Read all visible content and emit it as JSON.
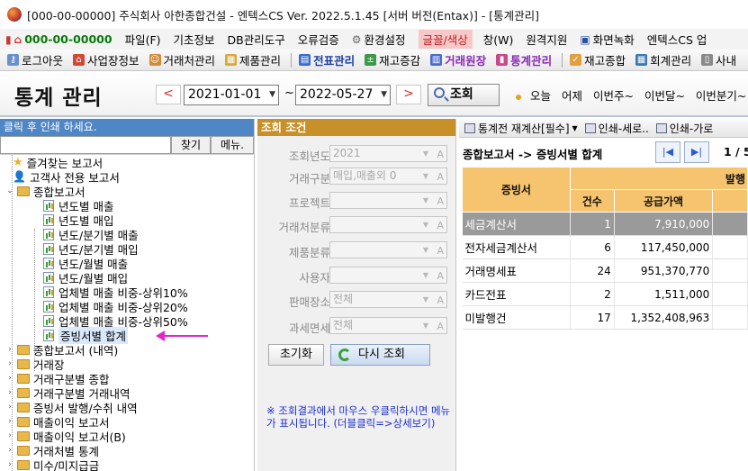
{
  "window": {
    "title": "[000-00-00000] 주식회사 아한종합건설 - 엔텍스CS Ver. 2022.5.1.45 [서버 버전(Entax)] - [통계관리]"
  },
  "menubar": {
    "code": "000-00-00000",
    "items": [
      "파일(F)",
      "기초정보",
      "DB관리도구",
      "오류검증",
      "환경설정",
      "글꼴/색상",
      "창(W)",
      "원격지원",
      "화면녹화",
      "엔텍스CS 업"
    ]
  },
  "toolbar": {
    "items": [
      "로그아웃",
      "사업장정보",
      "거래처관리",
      "제품관리",
      "전표관리",
      "재고증감",
      "거래원장",
      "통계관리",
      "재고종합",
      "회계관리",
      "사내"
    ]
  },
  "header": {
    "title": "통계 관리",
    "prev_label": "<",
    "next_label": ">",
    "date_from": "2021-01-01",
    "date_to": "2022-05-27",
    "tilde": "~",
    "search_label": "조회",
    "quick_ranges": [
      "오늘",
      "어제",
      "이번주~",
      "이번달~",
      "이번분기~"
    ]
  },
  "left": {
    "hint": "클릭 후 인쇄 하세요.",
    "find_label": "찾기",
    "menu_label": "메뉴.",
    "tree": [
      {
        "label": "즐겨찾는 보고서"
      },
      {
        "label": "고객사 전용 보고서"
      },
      {
        "label": "종합보고서"
      },
      {
        "label": "년도별 매출"
      },
      {
        "label": "년도별 매입"
      },
      {
        "label": "년도/분기별 매출"
      },
      {
        "label": "년도/분기별 매입"
      },
      {
        "label": "년도/월별 매출"
      },
      {
        "label": "년도/월별 매입"
      },
      {
        "label": "업체별 매출 비중-상위10%"
      },
      {
        "label": "업체별 매출 비중-상위20%"
      },
      {
        "label": "업체별 매출 비중-상위50%"
      },
      {
        "label": "증빙서별 합계"
      },
      {
        "label": "종합보고서 (내역)"
      },
      {
        "label": "거래장"
      },
      {
        "label": "거래구분별 종합"
      },
      {
        "label": "거래구분별 거래내역"
      },
      {
        "label": "증빙서 발행/수취 내역"
      },
      {
        "label": "매출이익 보고서"
      },
      {
        "label": "매출이익 보고서(B)"
      },
      {
        "label": "거래처별 통계"
      },
      {
        "label": "미수/미지급금"
      }
    ]
  },
  "conditions": {
    "header": "조회 조건",
    "fields": [
      {
        "label": "조회년도",
        "value": "2021"
      },
      {
        "label": "거래구분",
        "value": "매입,매출외 0"
      },
      {
        "label": "프로젝트",
        "value": ""
      },
      {
        "label": "거래처분류",
        "value": ""
      },
      {
        "label": "제품분류",
        "value": ""
      },
      {
        "label": "사용자",
        "value": ""
      },
      {
        "label": "판매장소",
        "value": "전체"
      },
      {
        "label": "과세면세",
        "value": "전체"
      }
    ],
    "abtn": "A",
    "reset_label": "초기화",
    "requery_label": "다시 조회",
    "note": "※ 조회결과에서 마우스 우클릭하시면 메뉴가 표시됩니다. (더블클릭=>상세보기)"
  },
  "results": {
    "toolbar": [
      "통계전 재계산[필수]",
      "인쇄-세로..",
      "인쇄-가로"
    ],
    "path": "종합보고서 -> 증빙서별 합계",
    "page_info": "1 / 5",
    "col_group": "발행",
    "columns": [
      "증빙서",
      "건수",
      "공급가액"
    ],
    "rows": [
      {
        "name": "세금계산서",
        "count": "1",
        "amount": "7,910,000"
      },
      {
        "name": "전자세금계산서",
        "count": "6",
        "amount": "117,450,000"
      },
      {
        "name": "거래명세표",
        "count": "24",
        "amount": "951,370,770"
      },
      {
        "name": "카드전표",
        "count": "2",
        "amount": "1,511,000"
      },
      {
        "name": "미발행건",
        "count": "17",
        "amount": "1,352,408,963"
      }
    ]
  },
  "colors": {
    "accent_blue": "#4f86c6",
    "condition_header": "#c89028",
    "grid_header": "#f6c46e",
    "arrow": "#e028c8"
  }
}
